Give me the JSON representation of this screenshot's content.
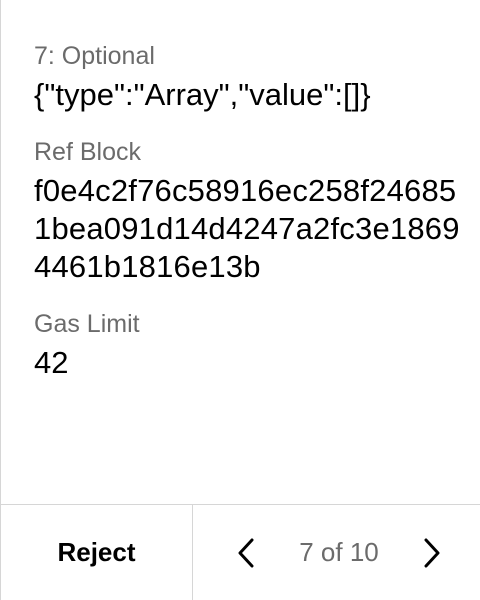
{
  "fields": [
    {
      "label": "7: Optional",
      "value": "{\"type\":\"Array\",\"value\":[]}"
    },
    {
      "label": "Ref Block",
      "value": "f0e4c2f76c58916ec258f246851bea091d14d4247a2fc3e18694461b1816e13b"
    },
    {
      "label": "Gas Limit",
      "value": "42"
    }
  ],
  "footer": {
    "reject_label": "Reject",
    "page_indicator": "7 of 10",
    "prev_icon": "chevron-left-icon",
    "next_icon": "chevron-right-icon"
  },
  "colors": {
    "label": "#6b6b6b",
    "text": "#000000",
    "divider": "#d6d6d6"
  }
}
